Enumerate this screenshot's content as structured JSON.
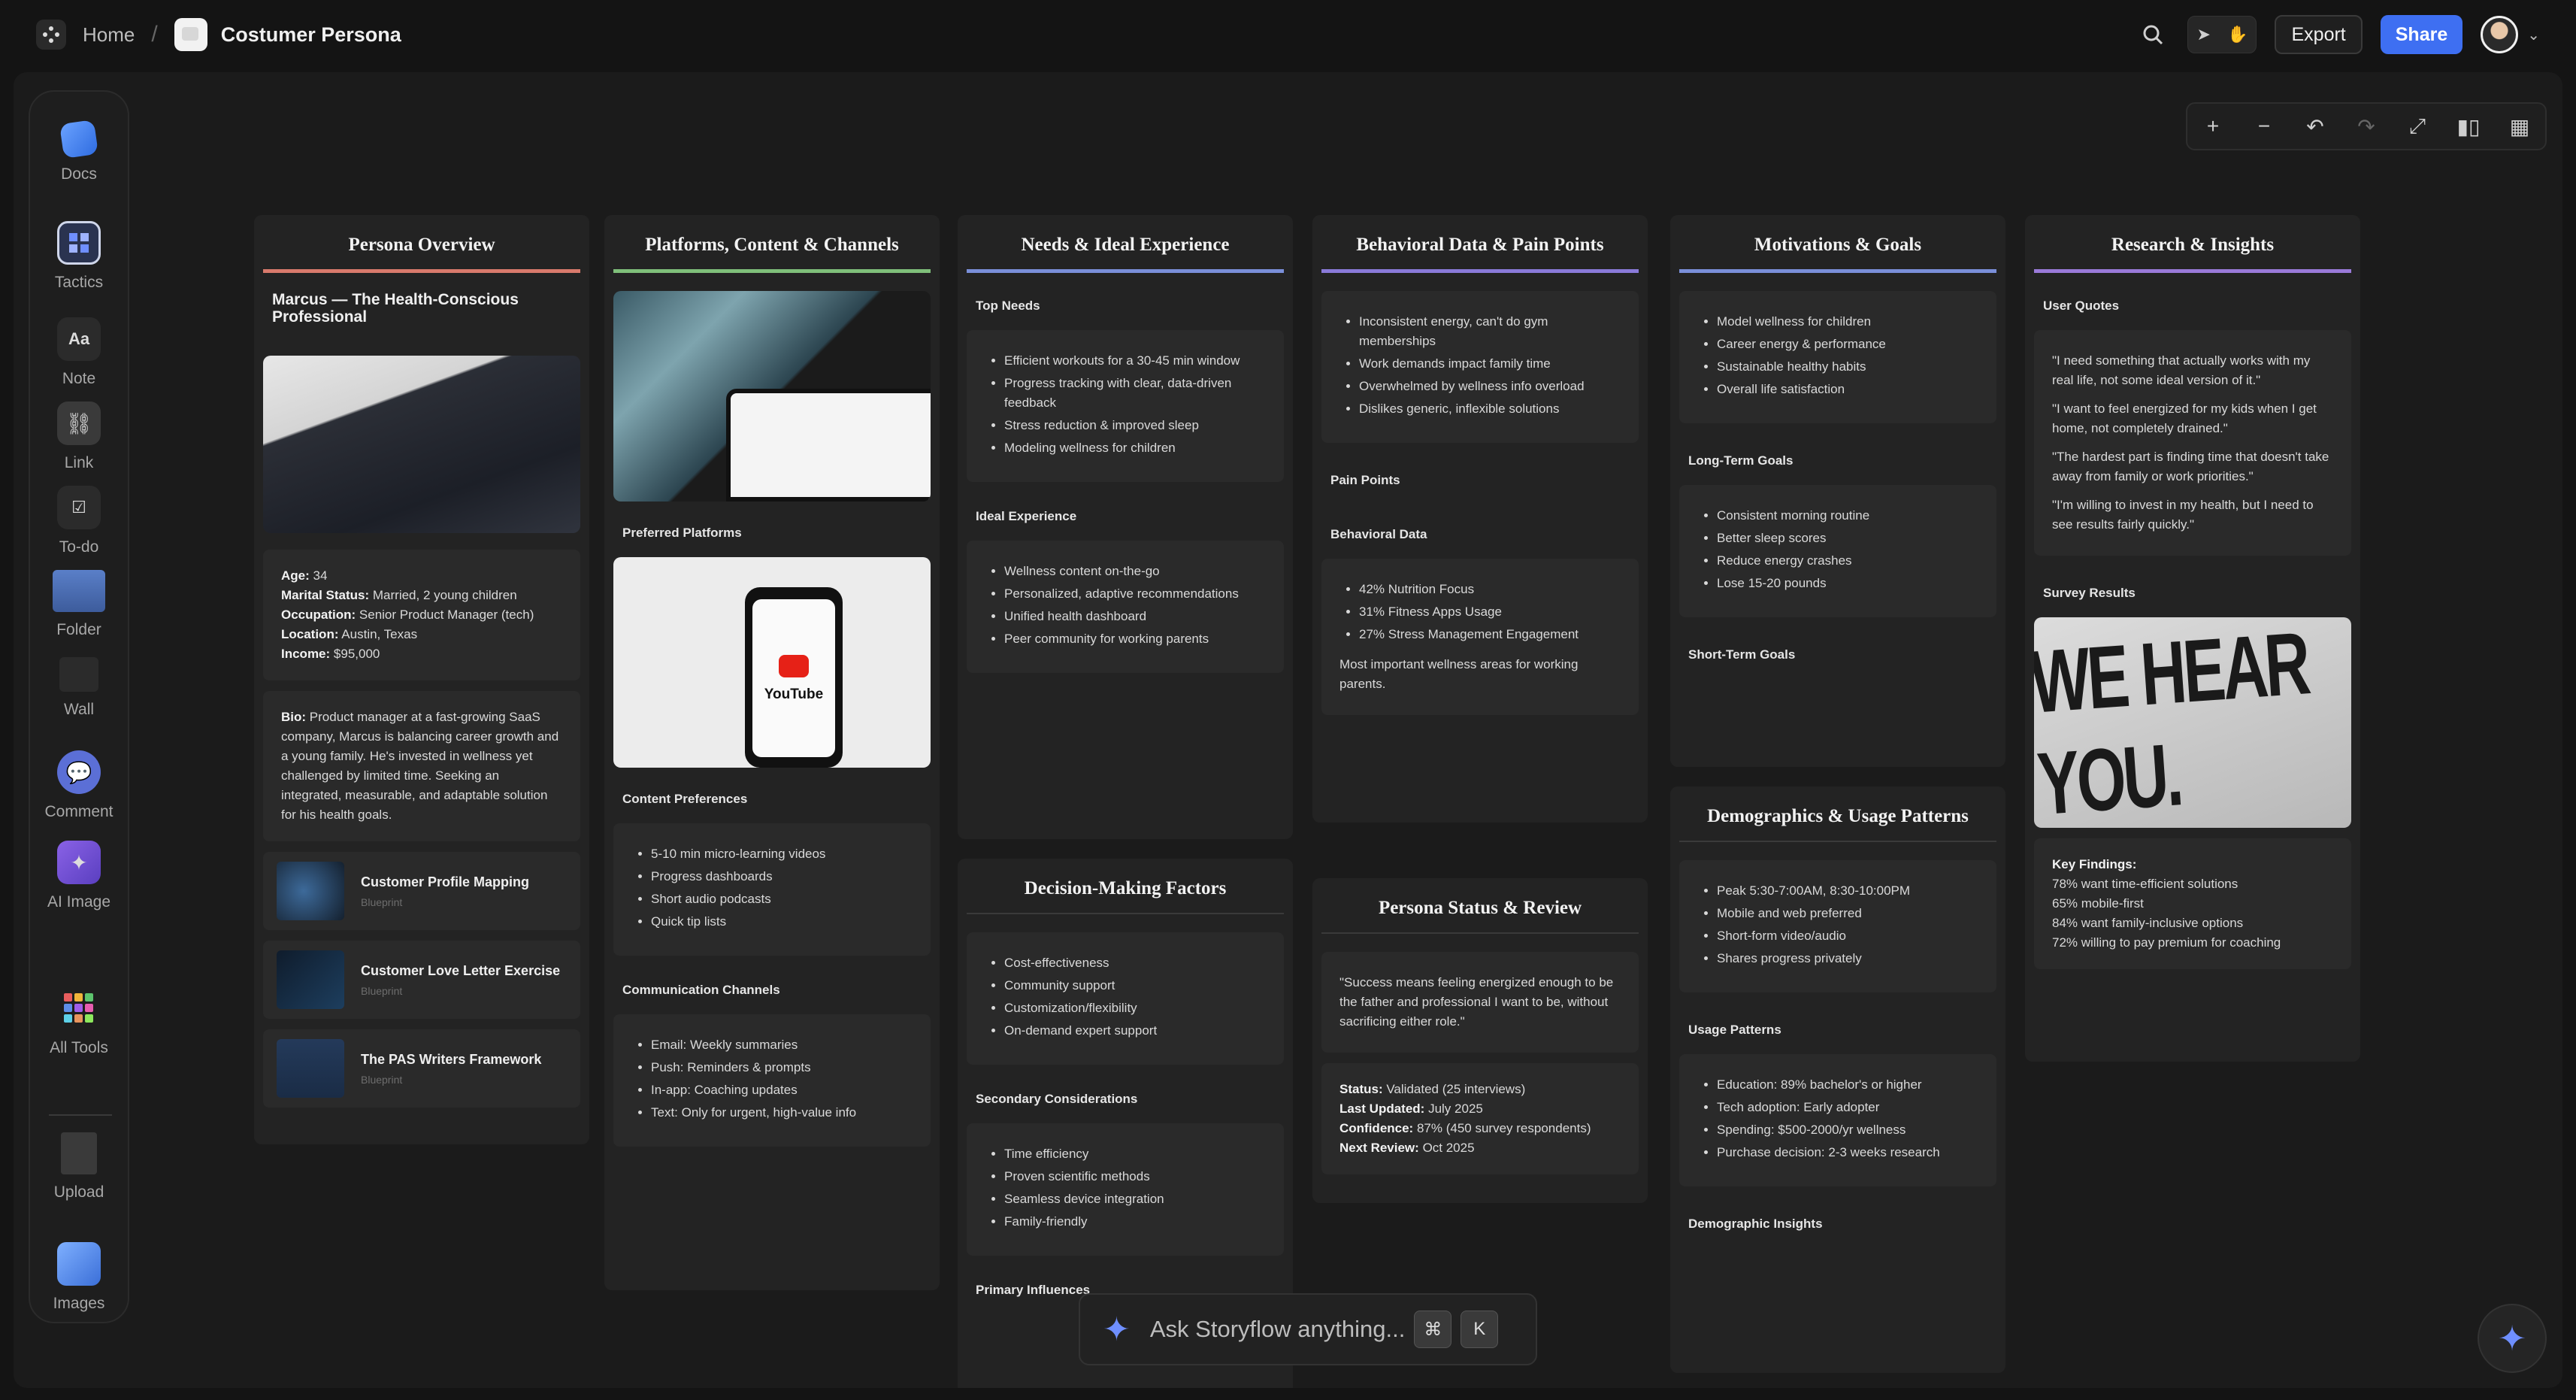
{
  "breadcrumb": {
    "home": "Home",
    "separator": "/",
    "title": "Costumer Persona"
  },
  "topbar": {
    "export_label": "Export",
    "share_label": "Share",
    "accent": "#3e6ff2"
  },
  "toolbar": {
    "tools": [
      {
        "label": "Docs",
        "icon": "docs-icon"
      },
      {
        "label": "Tactics",
        "icon": "tactics-icon"
      },
      {
        "label": "Note",
        "icon": "note-icon",
        "glyph": "Aa"
      },
      {
        "label": "Link",
        "icon": "link-icon"
      },
      {
        "label": "To-do",
        "icon": "todo-icon"
      },
      {
        "label": "Folder",
        "icon": "folder-icon"
      },
      {
        "label": "Wall",
        "icon": "wall-icon"
      },
      {
        "label": "Comment",
        "icon": "comment-icon"
      },
      {
        "label": "AI Image",
        "icon": "ai-image-icon"
      },
      {
        "label": "All Tools",
        "icon": "all-tools-icon"
      },
      {
        "label": "Upload",
        "icon": "upload-icon"
      },
      {
        "label": "Images",
        "icon": "images-icon"
      }
    ]
  },
  "columns": {
    "persona": {
      "title": "Persona Overview",
      "color": "#d97a6c",
      "name": "Marcus — The Health-Conscious Professional",
      "details": [
        {
          "k": "Age:",
          "v": "34"
        },
        {
          "k": "Marital Status:",
          "v": "Married, 2 young children"
        },
        {
          "k": "Occupation:",
          "v": "Senior Product Manager (tech)"
        },
        {
          "k": "Location:",
          "v": "Austin, Texas"
        },
        {
          "k": "Income:",
          "v": "$95,000"
        }
      ],
      "bio_label": "Bio:",
      "bio": "Product manager at a fast-growing SaaS company, Marcus is balancing career growth and a young family. He's invested in wellness yet challenged by limited time. Seeking an integrated, measurable, and adaptable solution for his health goals.",
      "blueprints": [
        {
          "title": "Customer Profile Mapping",
          "sub": "Blueprint"
        },
        {
          "title": "Customer Love Letter Exercise",
          "sub": "Blueprint"
        },
        {
          "title": "The PAS Writers Framework",
          "sub": "Blueprint"
        }
      ]
    },
    "platforms": {
      "title": "Platforms, Content & Channels",
      "color": "#7fbf7a",
      "preferred": "Preferred Platforms",
      "content_head": "Content Preferences",
      "content": [
        "5-10 min micro-learning videos",
        "Progress dashboards",
        "Short audio podcasts",
        "Quick tip lists"
      ],
      "channels_head": "Communication Channels",
      "channels": [
        "Email: Weekly summaries",
        "Push: Reminders & prompts",
        "In-app: Coaching updates",
        "Text: Only for urgent, high-value info"
      ],
      "youtube_text": "YouTube"
    },
    "needs": {
      "title": "Needs & Ideal Experience",
      "color": "#7a8fd9",
      "top_head": "Top Needs",
      "top": [
        "Efficient workouts for a 30-45 min window",
        "Progress tracking with clear, data-driven feedback",
        "Stress reduction & improved sleep",
        "Modeling wellness for children"
      ],
      "ideal_head": "Ideal Experience",
      "ideal": [
        "Wellness content on-the-go",
        "Personalized, adaptive recommendations",
        "Unified health dashboard",
        "Peer community for working parents"
      ]
    },
    "decision": {
      "title": "Decision-Making Factors",
      "items": [
        "Cost-effectiveness",
        "Community support",
        "Customization/flexibility",
        "On-demand expert support"
      ],
      "secondary_head": "Secondary Considerations",
      "secondary": [
        "Time efficiency",
        "Proven scientific methods",
        "Seamless device integration",
        "Family-friendly"
      ],
      "primary_head": "Primary Influences"
    },
    "behavior": {
      "title": "Behavioral Data & Pain Points",
      "color": "#8a7ad9",
      "pains": [
        "Inconsistent energy, can't do gym memberships",
        "Work demands impact family time",
        "Overwhelmed by wellness info overload",
        "Dislikes generic, inflexible solutions"
      ],
      "pain_head": "Pain Points",
      "data_head": "Behavioral Data",
      "data": [
        "42% Nutrition Focus",
        "31% Fitness Apps Usage",
        "27% Stress Management Engagement"
      ],
      "data_note": "Most important wellness areas for working parents."
    },
    "status": {
      "title": "Persona Status & Review",
      "quote": "\"Success means feeling energized enough to be the father and professional I want to be, without sacrificing either role.\"",
      "details": [
        {
          "k": "Status:",
          "v": "Validated (25 interviews)"
        },
        {
          "k": "Last Updated:",
          "v": "July 2025"
        },
        {
          "k": "Confidence:",
          "v": "87% (450 survey respondents)"
        },
        {
          "k": "Next Review:",
          "v": "Oct 2025"
        }
      ]
    },
    "motivations": {
      "title": "Motivations & Goals",
      "color": "#7a8fd9",
      "items": [
        "Model wellness for children",
        "Career energy & performance",
        "Sustainable healthy habits",
        "Overall life satisfaction"
      ],
      "long_head": "Long-Term Goals",
      "long": [
        "Consistent morning routine",
        "Better sleep scores",
        "Reduce energy crashes",
        "Lose 15-20 pounds"
      ],
      "short_head": "Short-Term Goals"
    },
    "demographics": {
      "title": "Demographics & Usage Patterns",
      "items": [
        "Peak 5:30-7:00AM, 8:30-10:00PM",
        "Mobile and web preferred",
        "Short-form video/audio",
        "Shares progress privately"
      ],
      "usage_head": "Usage Patterns",
      "usage": [
        "Education: 89% bachelor's or higher",
        "Tech adoption: Early adopter",
        "Spending: $500-2000/yr wellness",
        "Purchase decision: 2-3 weeks research"
      ],
      "insights_head": "Demographic Insights"
    },
    "research": {
      "title": "Research & Insights",
      "color": "#9a7ad9",
      "quotes_head": "User Quotes",
      "quotes": [
        "\"I need something that actually works with my real life, not some ideal version of it.\"",
        "\"I want to feel energized for my kids when I get home, not completely drained.\"",
        "\"The hardest part is finding time that doesn't take away from family or work priorities.\"",
        "\"I'm willing to invest in my health, but I need to see results fairly quickly.\""
      ],
      "survey_head": "Survey Results",
      "poster_text": "WE HEAR YOU.",
      "findings_head": "Key Findings:",
      "findings": [
        "78% want time-efficient solutions",
        "65% mobile-first",
        "84% want family-inclusive options",
        "72% willing to pay premium for coaching"
      ]
    }
  },
  "ask": {
    "placeholder": "Ask Storyflow anything...",
    "key1": "⌘",
    "key2": "K"
  }
}
